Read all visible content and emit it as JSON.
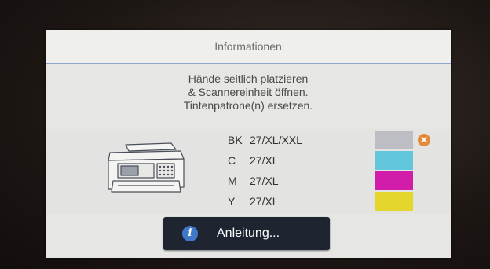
{
  "dialog": {
    "title": "Informationen",
    "message_lines": [
      "Hände seitlich platzieren",
      "& Scannereinheit öffnen.",
      "Tintenpatrone(n) ersetzen."
    ]
  },
  "cartridges": [
    {
      "code": "BK",
      "model": "27/XL/XXL",
      "color": "#bdbec4",
      "status": "error",
      "icon": "error-x-icon"
    },
    {
      "code": "C",
      "model": "27/XL",
      "color": "#62c6dd",
      "status": "ok"
    },
    {
      "code": "M",
      "model": "27/XL",
      "color": "#d21dab",
      "status": "ok"
    },
    {
      "code": "Y",
      "model": "27/XL",
      "color": "#e5d62d",
      "status": "ok"
    }
  ],
  "guide_button": {
    "label": "Anleitung...",
    "icon": "info-icon"
  },
  "colors": {
    "title_divider": "#8fa4c8",
    "warning": "#e38a3a",
    "button_bg": "#1f2530",
    "info_blue": "#3f79c9"
  }
}
